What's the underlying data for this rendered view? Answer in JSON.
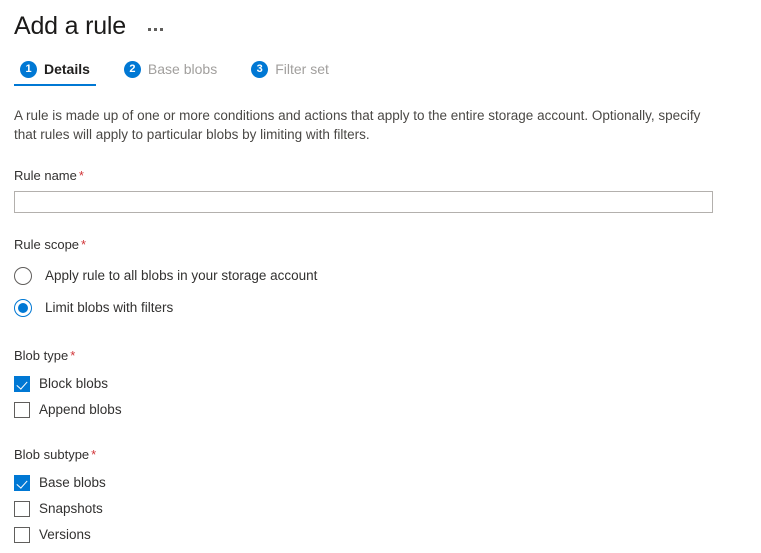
{
  "header": {
    "title": "Add a rule",
    "more_menu_label": "More options"
  },
  "tabs": [
    {
      "number": "1",
      "label": "Details",
      "active": true
    },
    {
      "number": "2",
      "label": "Base blobs",
      "active": false
    },
    {
      "number": "3",
      "label": "Filter set",
      "active": false
    }
  ],
  "description": "A rule is made up of one or more conditions and actions that apply to the entire storage account. Optionally, specify that rules will apply to particular blobs by limiting with filters.",
  "fields": {
    "rule_name": {
      "label": "Rule name",
      "required_marker": "*",
      "value": "",
      "placeholder": ""
    },
    "rule_scope": {
      "label": "Rule scope",
      "required_marker": "*",
      "options": [
        {
          "label": "Apply rule to all blobs in your storage account",
          "checked": false
        },
        {
          "label": "Limit blobs with filters",
          "checked": true
        }
      ]
    },
    "blob_type": {
      "label": "Blob type",
      "required_marker": "*",
      "options": [
        {
          "label": "Block blobs",
          "checked": true
        },
        {
          "label": "Append blobs",
          "checked": false
        }
      ]
    },
    "blob_subtype": {
      "label": "Blob subtype",
      "required_marker": "*",
      "options": [
        {
          "label": "Base blobs",
          "checked": true
        },
        {
          "label": "Snapshots",
          "checked": false
        },
        {
          "label": "Versions",
          "checked": false
        }
      ]
    }
  },
  "colors": {
    "accent": "#0078d4",
    "required": "#d13438",
    "title": "#1b1a19",
    "inactive_tab": "#a19f9d"
  }
}
